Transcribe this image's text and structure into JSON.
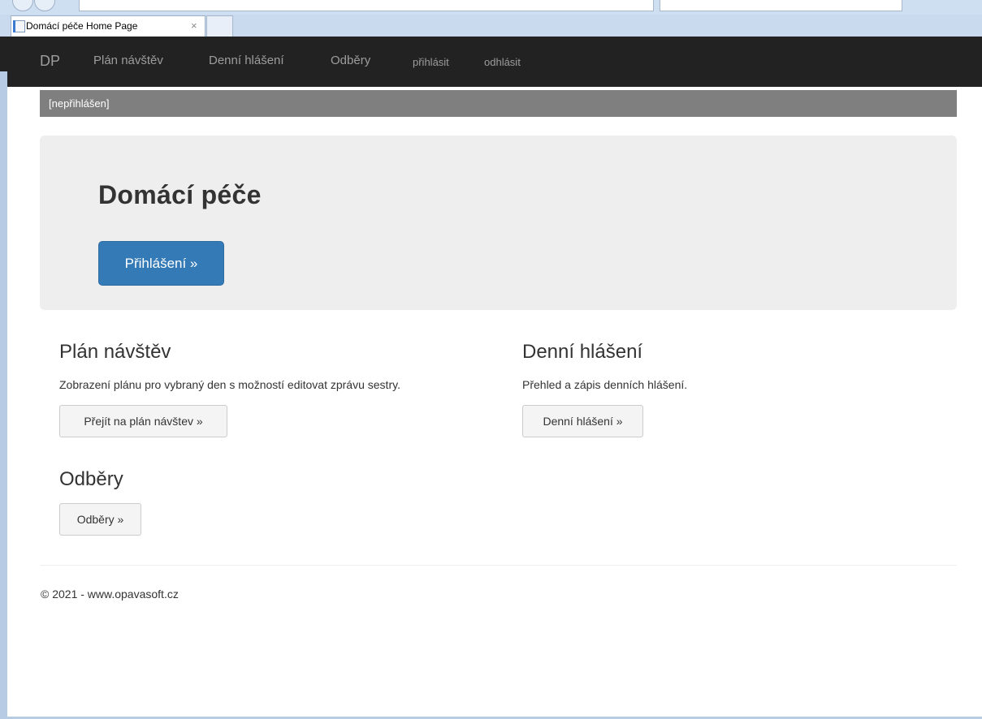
{
  "browser": {
    "tab_title": "Domácí péče Home Page",
    "tab_close": "×"
  },
  "navbar": {
    "brand": "DP",
    "items": [
      "Plán návštěv",
      "Denní hlášení",
      "Odběry",
      "přihlásit",
      "odhlásit"
    ]
  },
  "status": "[nepřihlášen]",
  "jumbotron": {
    "title": "Domácí péče",
    "button": "Přihlášení »"
  },
  "sections": [
    {
      "title": "Plán návštěv",
      "text": "Zobrazení plánu pro vybraný den s možností editovat zprávu sestry.",
      "button": "Přejít na plán návštev »"
    },
    {
      "title": "Denní hlášení",
      "text": "Přehled a zápis denních hlášení.",
      "button": "Denní hlášení »"
    },
    {
      "title": "Odběry",
      "button": "Odběry »"
    }
  ],
  "footer": "© 2021 - www.opavasoft.cz",
  "colors": {
    "navbar": "#222222",
    "primary": "#337ab7",
    "status_bar": "#7f7f7f",
    "jumbotron": "#eeeeee"
  }
}
